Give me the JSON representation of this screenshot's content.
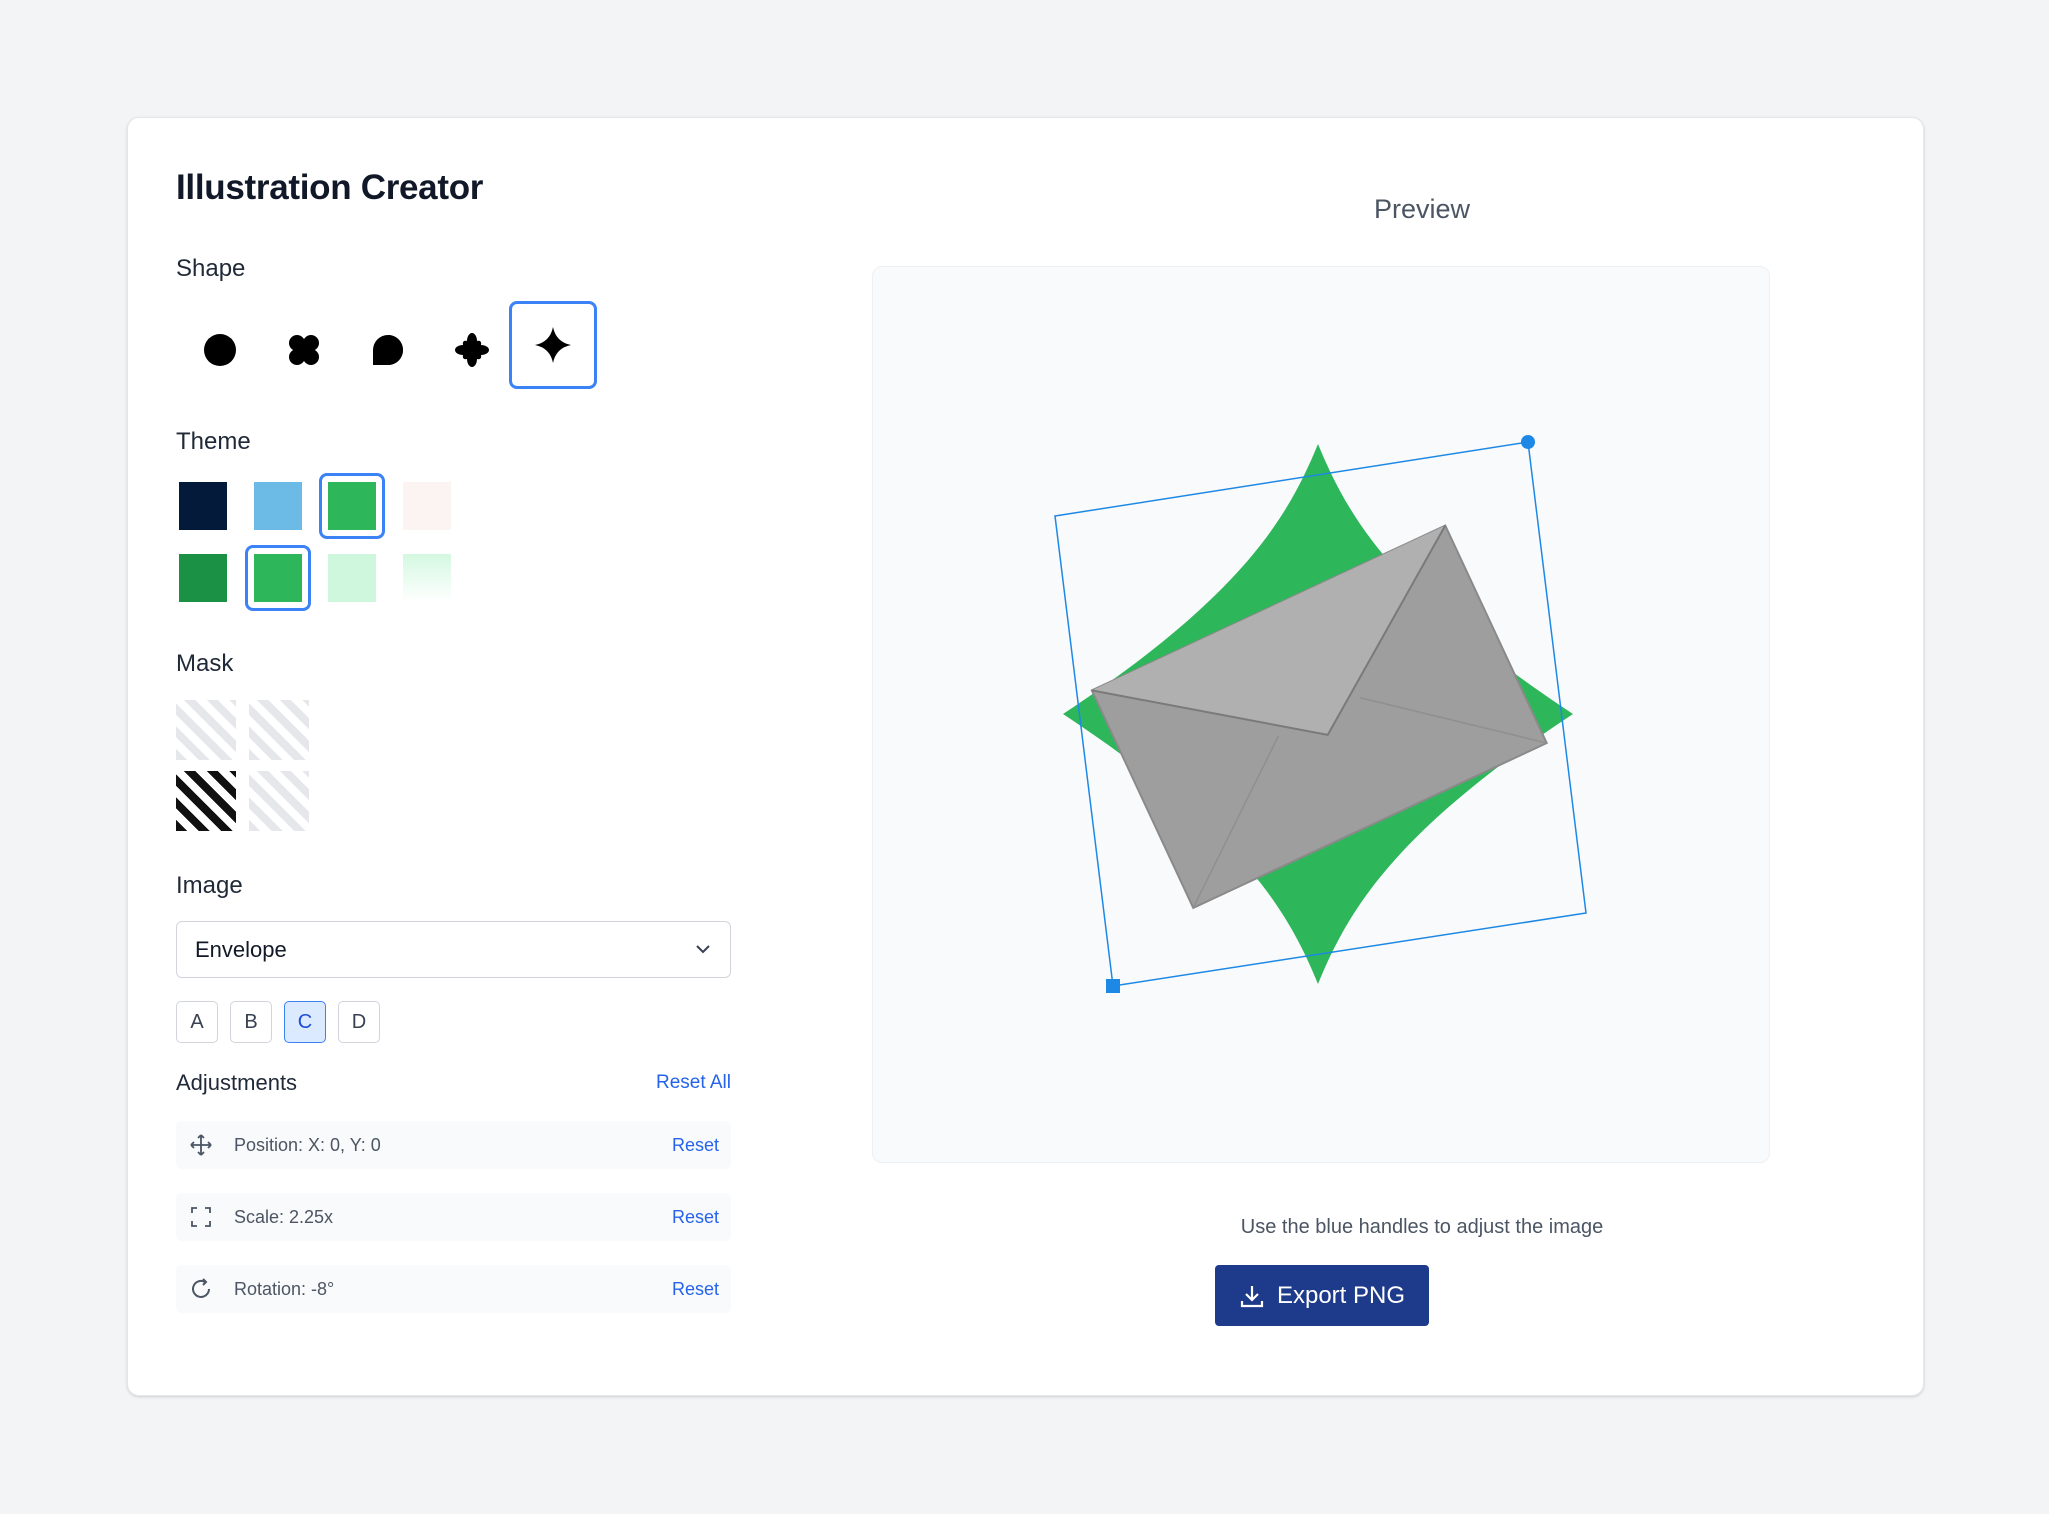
{
  "app": {
    "title": "Illustration Creator"
  },
  "shape": {
    "label": "Shape",
    "options": [
      "circle-icon",
      "flower-icon",
      "speech-bubble-icon",
      "asterisk-icon",
      "sparkle-icon"
    ],
    "selected": "sparkle-icon"
  },
  "theme": {
    "label": "Theme",
    "row1": [
      "#041a3a",
      "#6bbbe6",
      "#2eb65b",
      "#fbf4f2"
    ],
    "row2": [
      "#1b9145",
      "#2eb65b",
      "#cff7dd",
      "gradient-#d4f8e1"
    ],
    "selected_row1": "#2eb65b",
    "selected_row2": "#2eb65b"
  },
  "mask": {
    "label": "Mask",
    "selected": "diagonal-stripes-dark"
  },
  "image": {
    "label": "Image",
    "selected": "Envelope",
    "variants": [
      "A",
      "B",
      "C",
      "D"
    ],
    "selected_variant": "C"
  },
  "adjustments": {
    "label": "Adjustments",
    "reset_all": "Reset All",
    "position": {
      "text": "Position: X: 0, Y: 0",
      "reset": "Reset"
    },
    "scale": {
      "text": "Scale: 2.25x",
      "reset": "Reset"
    },
    "rotation": {
      "text": "Rotation: -8°",
      "reset": "Reset"
    }
  },
  "preview": {
    "title": "Preview",
    "hint": "Use the blue handles to adjust the image",
    "export_label": "Export PNG",
    "accent": "#2eb65b",
    "handle_color": "#1e88e5"
  }
}
